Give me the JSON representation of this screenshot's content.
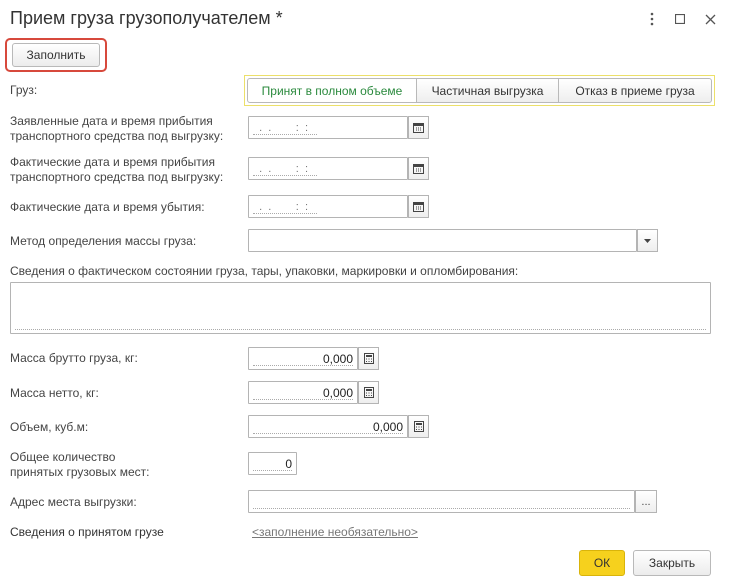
{
  "window": {
    "title": "Прием груза грузополучателем *",
    "more_icon": "more-vertical-icon",
    "maximize_icon": "maximize-icon",
    "close_icon": "close-icon"
  },
  "toolbar": {
    "fill_label": "Заполнить"
  },
  "cargo": {
    "label": "Груз:",
    "options": [
      "Принят в полном объеме",
      "Частичная выгрузка",
      "Отказ в приеме груза"
    ],
    "selected": "Принят в полном объеме",
    "selected_color": "#2b8a3e"
  },
  "declared_arrival": {
    "label_line1": "Заявленные дата и время прибытия",
    "label_line2": "транспортного средства под выгрузку:",
    "mask": "  .  .        :  :",
    "icon": "calendar-icon"
  },
  "actual_arrival": {
    "label_line1": "Фактические дата и время прибытия",
    "label_line2": "транспортного средства под выгрузку:",
    "mask": "  .  .        :  :",
    "icon": "calendar-icon"
  },
  "actual_departure": {
    "label": "Фактические дата и время убытия:",
    "mask": "  .  .        :  :",
    "icon": "calendar-icon"
  },
  "mass_method": {
    "label": "Метод определения массы груза:",
    "value": "",
    "icon": "chevron-down-icon"
  },
  "condition": {
    "label": "Сведения о фактическом состоянии груза, тары, упаковки, маркировки и опломбирования:",
    "value": ""
  },
  "gross_mass": {
    "label": "Масса брутто груза, кг:",
    "value": "0,000",
    "icon": "calculator-icon"
  },
  "net_mass": {
    "label": "Масса нетто, кг:",
    "value": "0,000",
    "icon": "calculator-icon"
  },
  "volume": {
    "label": "Объем, куб.м:",
    "value": "0,000",
    "icon": "calculator-icon"
  },
  "places": {
    "label_line1": "Общее количество",
    "label_line2": "принятых грузовых мест:",
    "value": "0"
  },
  "unload_address": {
    "label": "Адрес места выгрузки:",
    "value": "",
    "select_label": "..."
  },
  "accepted_info": {
    "label": "Сведения о принятом грузе",
    "link": "<заполнение необязательно>"
  },
  "footer": {
    "ok_label": "ОК",
    "close_label": "Закрыть",
    "ok_color": "#f6d11d"
  }
}
